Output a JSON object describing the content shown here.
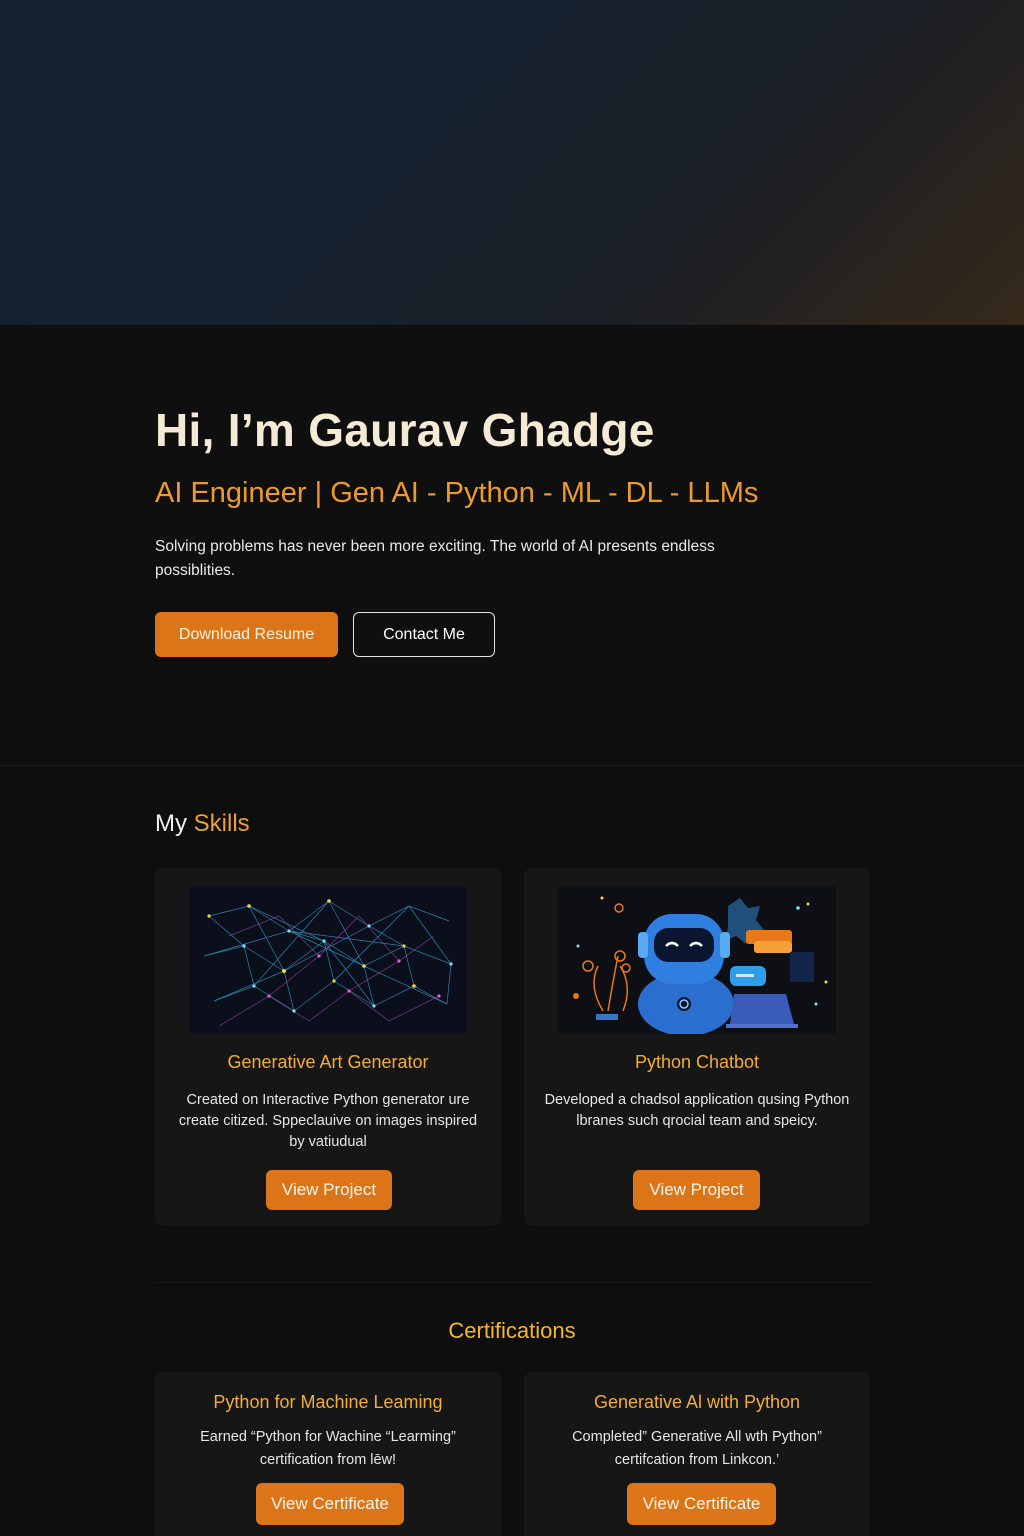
{
  "hero": {
    "title": "Hi, I’m Gaurav Ghadge",
    "subtitle": "AI Engineer | Gen AI - Python - ML - DL - LLMs",
    "description": "Solving problems has never been more exciting. The world of AI presents endless possiblities.",
    "download_label": "Download Resume",
    "contact_label": "Contact Me"
  },
  "skills": {
    "heading_prefix": "My",
    "heading_accent": "Skills",
    "cards": [
      {
        "title": "Generative Art Generator",
        "description": "Created on Interactive Python generator ure create citized. Sppeclauive on images inspired by vatiudual",
        "button_label": "View Project",
        "image_icon": "neural-network-image"
      },
      {
        "title": "Python Chatbot",
        "description": "Developed a chadsol application qusing Python lbranes such qrocial team and speicy.",
        "button_label": "View Project",
        "image_icon": "robot-chatbot-image"
      }
    ]
  },
  "certifications": {
    "heading": "Certifications",
    "cards": [
      {
        "title": "Python for Machine Leaming",
        "description": "Earned “Python for Wachine “Learming” certification from lēw!",
        "button_label": "View Certificate"
      },
      {
        "title": "Generative Al with Python",
        "description": "Completed” Generative All wth Python” certifcation from Linkcon.’",
        "button_label": "View Certificate"
      }
    ]
  },
  "colors": {
    "accent_orange": "#dc7418",
    "accent_gold": "#f3ad33",
    "background": "#0e0e0f",
    "card_background": "#161617"
  }
}
